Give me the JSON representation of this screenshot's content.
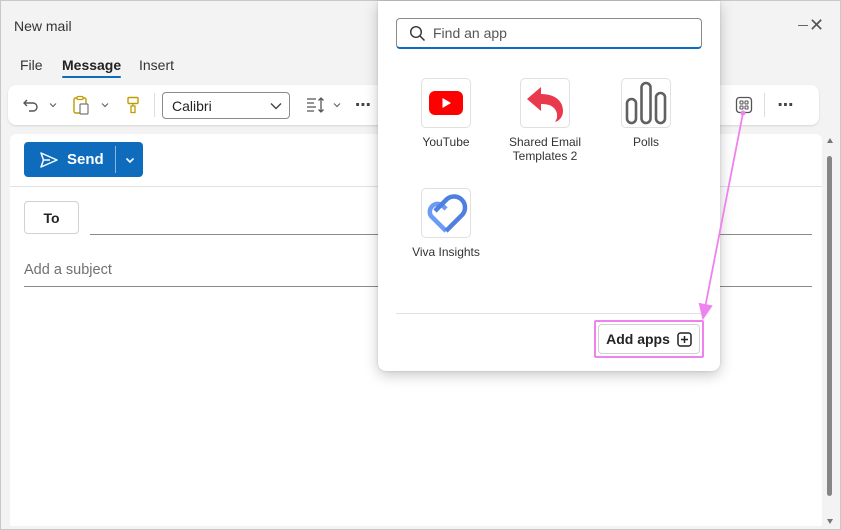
{
  "window": {
    "title": "New mail"
  },
  "menu_tabs": [
    {
      "label": "File"
    },
    {
      "label": "Message"
    },
    {
      "label": "Insert"
    }
  ],
  "ribbon": {
    "font_name": "Calibri"
  },
  "compose": {
    "send_label": "Send",
    "to_label": "To",
    "subject_placeholder": "Add a subject"
  },
  "apps_popup": {
    "search_placeholder": "Find an app",
    "apps": [
      {
        "label": "YouTube",
        "icon": "youtube-icon"
      },
      {
        "label": "Shared Email Templates 2",
        "label_line1": "Shared Email",
        "label_line2": "Templates 2",
        "icon": "shared-email-templates-icon"
      },
      {
        "label": "Polls",
        "icon": "polls-icon"
      },
      {
        "label": "Viva Insights",
        "icon": "viva-insights-icon"
      }
    ],
    "add_apps_label": "Add apps"
  },
  "colors": {
    "accent": "#0f6cbd",
    "highlight": "#ee82ee",
    "youtube_red": "#ff0000",
    "templates_red": "#e8394d",
    "viva_blue": "#5b8def"
  }
}
